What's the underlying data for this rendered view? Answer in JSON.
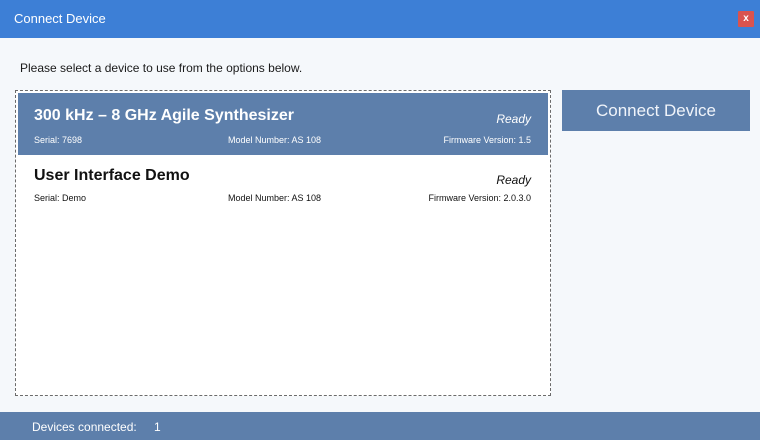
{
  "window": {
    "title": "Connect Device",
    "close_label": "x"
  },
  "instruction": "Please select a device to use from the options below.",
  "devices": [
    {
      "name": "300 kHz – 8 GHz Agile Synthesizer",
      "status": "Ready",
      "serial": "Serial: 7698",
      "model": "Model Number: AS 108",
      "firmware": "Firmware Version: 1.5",
      "selected": true
    },
    {
      "name": "User Interface Demo",
      "status": "Ready",
      "serial": "Serial: Demo",
      "model": "Model Number: AS 108",
      "firmware": "Firmware Version: 2.0.3.0",
      "selected": false
    }
  ],
  "connect_button_label": "Connect Device",
  "statusbar": {
    "label": "Devices connected:",
    "count": "1"
  },
  "colors": {
    "titlebar": "#3d7fd6",
    "accent": "#5d7fab",
    "close": "#d9534f"
  }
}
